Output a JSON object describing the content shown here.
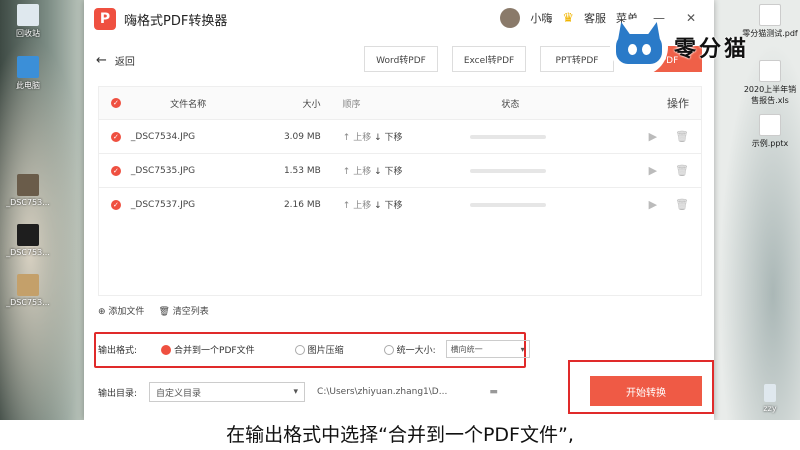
{
  "desktop": {
    "left_icons": [
      {
        "label": "回收站"
      },
      {
        "label": "此电脑"
      },
      {
        "label": "_DSC753..."
      },
      {
        "label": "_DSC753..."
      },
      {
        "label": "_DSC753..."
      }
    ],
    "right_icons": [
      {
        "label": "零分猫测试.pdf"
      },
      {
        "label": "2020上半年销售报告.xls"
      },
      {
        "label": "示例.pptx"
      },
      {
        "label": "zzy"
      }
    ]
  },
  "app": {
    "title": "嗨格式PDF转换器",
    "logo_glyph": "P",
    "user_name": "小嗨",
    "service_label": "客服",
    "menu_label": "菜单",
    "back_label": "返回",
    "tabs": [
      {
        "label": "Word转PDF"
      },
      {
        "label": "Excel转PDF"
      },
      {
        "label": "PPT转PDF"
      },
      {
        "label": "转PDF"
      }
    ],
    "table": {
      "headers": {
        "name": "文件名称",
        "size": "大小",
        "order": "顺序",
        "status": "状态",
        "op": "操作"
      },
      "rows": [
        {
          "name": "_DSC7534.JPG",
          "size": "3.09 MB",
          "up": "上移",
          "down": "下移"
        },
        {
          "name": "_DSC7535.JPG",
          "size": "1.53 MB",
          "up": "上移",
          "down": "下移"
        },
        {
          "name": "_DSC7537.JPG",
          "size": "2.16 MB",
          "up": "上移",
          "down": "下移"
        }
      ]
    },
    "add_file_label": "添加文件",
    "clear_list_label": "清空列表",
    "output_format_label": "输出格式:",
    "format_options": {
      "merge": "合并到一个PDF文件",
      "compress": "图片压缩",
      "uniform": "统一大小:",
      "uniform_select": "横向统一"
    },
    "output_dir_label": "输出目录:",
    "dir_select": "自定义目录",
    "dir_path": "C:\\Users\\zhiyuan.zhang1\\D...",
    "start_button": "开始转换"
  },
  "watermark": {
    "text": "零分猫"
  },
  "subtitle": "在输出格式中选择“合并到一个PDF文件”,",
  "colors": {
    "accent": "#ef5040",
    "highlight_box": "#e02a2a"
  }
}
